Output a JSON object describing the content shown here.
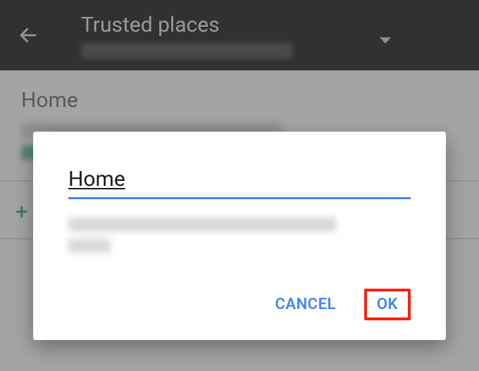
{
  "appbar": {
    "title": "Trusted places"
  },
  "content": {
    "place_title": "Home",
    "add_icon_glyph": "+"
  },
  "dialog": {
    "input_value": "Home",
    "cancel_label": "CANCEL",
    "ok_label": "OK"
  }
}
